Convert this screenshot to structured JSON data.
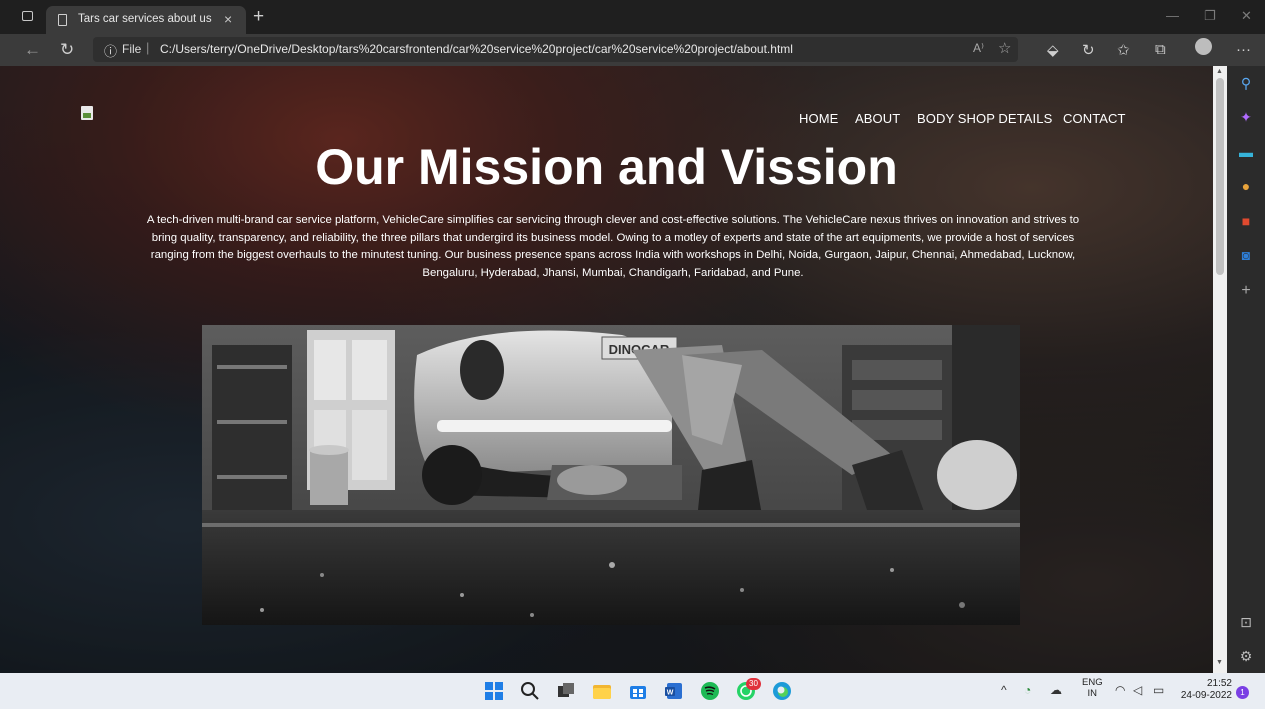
{
  "browser": {
    "tab_title": "Tars car services about us",
    "tab_close": "×",
    "new_tab": "+",
    "address_info_icon": "ⓘ",
    "address_scheme": "File",
    "address_separator": "|",
    "url": "C:/Users/terry/OneDrive/Desktop/tars%20carsfrontend/car%20service%20project/car%20service%20project/about.html",
    "read_aloud": "A⁾",
    "menu": "···"
  },
  "page": {
    "nav": [
      "HOME",
      "ABOUT",
      "BODY SHOP DETAILS",
      "CONTACT"
    ],
    "title": "Our Mission and Vission",
    "body": "A tech-driven multi-brand car service platform, VehicleCare simplifies car servicing through clever and cost-effective solutions. The VehicleCare nexus thrives on innovation and strives to bring quality, transparency, and reliability, the three pillars that undergird its business model. Owing to a motley of experts and state of the art equipments, we provide a host of services ranging from the biggest overhauls to the minutest tuning. Our business presence spans across India with workshops in Delhi, Noida, Gurgaon, Jaipur, Chennai, Ahmedabad, Lucknow, Bengaluru, Hyderabad, Jhansi, Mumbai, Chandigarh, Faridabad, and Pune.",
    "photo_plate": "DINOCAR"
  },
  "taskbar": {
    "whatsapp_badge": "30",
    "lang_line1": "ENG",
    "lang_line2": "IN",
    "time": "21:52",
    "date": "24-09-2022",
    "notification_count": "1"
  }
}
